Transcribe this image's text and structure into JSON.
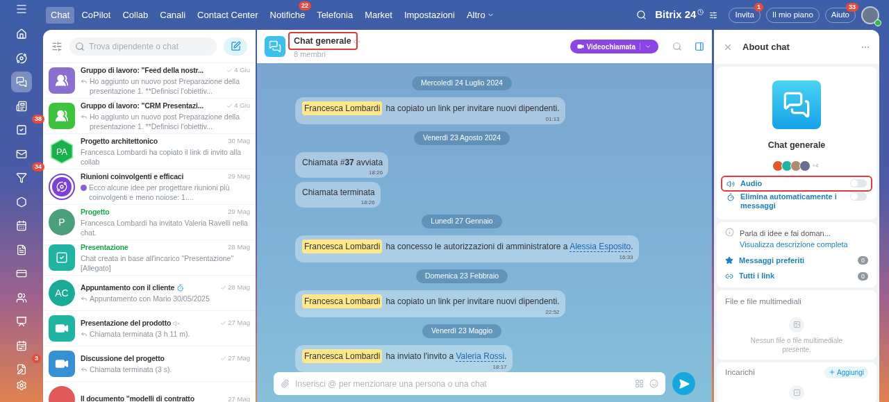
{
  "rail": {
    "items": [
      {
        "selected": false
      },
      {
        "selected": false
      },
      {
        "selected": true
      },
      {
        "selected": false
      },
      {
        "selected": false,
        "badge": "38"
      },
      {
        "selected": false
      },
      {
        "selected": false,
        "badge": "34"
      },
      {
        "selected": false
      },
      {
        "selected": false
      },
      {
        "selected": false
      },
      {
        "selected": false
      },
      {
        "selected": false
      },
      {
        "selected": false
      },
      {
        "selected": false
      },
      {
        "selected": false,
        "badge": "3"
      }
    ]
  },
  "nav": {
    "items": [
      {
        "label": "Chat",
        "selected": true,
        "dropdown": false
      },
      {
        "label": "CoPilot",
        "selected": false,
        "dropdown": false
      },
      {
        "label": "Collab",
        "selected": false,
        "dropdown": false
      },
      {
        "label": "Canali",
        "selected": false,
        "dropdown": false
      },
      {
        "label": "Contact Center",
        "selected": false,
        "dropdown": false
      },
      {
        "label": "Notifiche",
        "selected": false,
        "dropdown": false,
        "badge": "22"
      },
      {
        "label": "Telefonia",
        "selected": false,
        "dropdown": false
      },
      {
        "label": "Market",
        "selected": false,
        "dropdown": false
      },
      {
        "label": "Impostazioni",
        "selected": false,
        "dropdown": false
      },
      {
        "label": "Altro",
        "selected": false,
        "dropdown": true
      }
    ]
  },
  "header_right": {
    "logo": "Bitrix",
    "logo_num": "24",
    "buttons": [
      {
        "label": "Invita",
        "badge": "1"
      },
      {
        "label": "Il mio piano"
      },
      {
        "label": "Aiuto",
        "badge": "33"
      }
    ]
  },
  "chat_list": {
    "search_placeholder": "Trova dipendente o chat",
    "items": [
      {
        "title": "Gruppo di lavoro: \"Feed della nostr...",
        "date": "4 Giu",
        "preview": "Ho aggiunto un nuovo post Preparazione della presentazione 1. **Definisci l'obiettiv...",
        "read": true,
        "reply": true,
        "bot": false,
        "timer": false,
        "muted": false,
        "highlighted": false,
        "avatar": {
          "kind": "group",
          "color": "#8a6fd0"
        }
      },
      {
        "title": "Gruppo di lavoro: \"CRM Presentazi...",
        "date": "4 Giu",
        "preview": "Ho aggiunto un nuovo post Preparazione della presentazione 1. **Definisci l'obiettiv...",
        "read": true,
        "reply": true,
        "bot": false,
        "timer": false,
        "muted": false,
        "highlighted": false,
        "avatar": {
          "kind": "group",
          "color": "#3ec33e"
        }
      },
      {
        "title": "Progetto architettonico",
        "date": "30 Mag",
        "preview": "Francesca Lombardi ha copiato il link di invito alla collab",
        "read": false,
        "reply": false,
        "bot": false,
        "timer": false,
        "muted": false,
        "highlighted": false,
        "avatar": {
          "kind": "hexagon",
          "color": "#19b24a",
          "initials": "PA"
        }
      },
      {
        "title": "Riunioni coinvolgenti e efficaci",
        "date": "29 Mag",
        "preview": "Ecco alcune idee per progettare riunioni più coinvolgenti e meno noiose: 1....",
        "read": false,
        "reply": false,
        "bot": true,
        "timer": false,
        "muted": false,
        "highlighted": false,
        "avatar": {
          "kind": "copilot",
          "color": "#7b3fe0"
        }
      },
      {
        "title": "Progetto",
        "date": "29 Mag",
        "preview": "Francesca Lombardi ha invitato Valeria Ravelli nella chat.",
        "read": false,
        "reply": false,
        "bot": false,
        "timer": false,
        "muted": false,
        "highlighted": true,
        "avatar": {
          "kind": "initials",
          "color": "#4aa07a",
          "initials": "P"
        }
      },
      {
        "title": "Presentazione",
        "date": "28 Mag",
        "preview": "Chat creata in base all'incarico \"Presentazione\" [Allegato]",
        "read": false,
        "reply": false,
        "bot": false,
        "timer": false,
        "muted": false,
        "highlighted": true,
        "avatar": {
          "kind": "task",
          "color": "#1fb5a2"
        }
      },
      {
        "title": "Appuntamento con il cliente",
        "date": "28 Mag",
        "preview": "Appuntamento con Mario 30/05/2025",
        "read": true,
        "reply": true,
        "bot": false,
        "timer": true,
        "muted": false,
        "highlighted": false,
        "avatar": {
          "kind": "initials",
          "color": "#1aab98",
          "initials": "AC"
        }
      },
      {
        "title": "Presentazione del prodotto",
        "date": "27 Mag",
        "preview": "Chiamata terminata (3 h 11 m).",
        "read": true,
        "reply": true,
        "bot": false,
        "timer": false,
        "muted": true,
        "highlighted": false,
        "avatar": {
          "kind": "video",
          "color": "#1fb5a2"
        }
      },
      {
        "title": "Discussione del progetto",
        "date": "27 Mag",
        "preview": "Chiamata terminata (3 s).",
        "read": true,
        "reply": true,
        "bot": false,
        "timer": false,
        "muted": false,
        "highlighted": false,
        "avatar": {
          "kind": "video",
          "color": "#3591d4"
        }
      },
      {
        "title": "Il documento \"modelli di contratto",
        "date": "27 Mag",
        "read": false,
        "reply": false,
        "bot": false,
        "timer": false,
        "muted": false,
        "highlighted": false,
        "avatar": {
          "kind": "plain",
          "color": "#e05a5a"
        }
      }
    ]
  },
  "chat": {
    "title": "Chat generale",
    "subtitle": "8 membri",
    "muted": true,
    "highlighted": true,
    "call_button": "Videochiamata",
    "timeline": [
      {
        "kind": "date",
        "text": "Mercoledì 24 Luglio 2024"
      },
      {
        "kind": "message",
        "author": "Francesca Lombardi",
        "text": "ha copiato un link per invitare nuovi dipendenti.",
        "time": "01:13"
      },
      {
        "kind": "date",
        "text": "Venerdì 23 Agosto 2024"
      },
      {
        "kind": "message",
        "text": "Chiamata #**37** avviata",
        "time": "18:26"
      },
      {
        "kind": "message",
        "text": "Chiamata terminata",
        "time": "18:26"
      },
      {
        "kind": "date",
        "text": "Lunedì 27 Gennaio"
      },
      {
        "kind": "message",
        "author": "Francesca Lombardi",
        "text": "ha concesso le autorizzazioni di amministratore a",
        "link": "Alessia Esposito",
        "after": ".",
        "time": "16:33"
      },
      {
        "kind": "date",
        "text": "Domenica 23 Febbraio"
      },
      {
        "kind": "message",
        "author": "Francesca Lombardi",
        "text": "ha copiato un link per invitare nuovi dipendenti.",
        "time": "22:52"
      },
      {
        "kind": "date",
        "text": "Venerdì 23 Maggio"
      },
      {
        "kind": "message",
        "author": "Francesca Lombardi",
        "text": "ha inviato l'invito a",
        "link": "Valeria Rossi",
        "after": ".",
        "time": "18:17"
      }
    ],
    "composer_placeholder": "Inserisci @ per menzionare una persona o una chat"
  },
  "about": {
    "title": "About chat",
    "name": "Chat generale",
    "members_more": "+4",
    "settings": [
      {
        "label": "Audio",
        "on": false,
        "highlighted": true
      },
      {
        "label": "Elimina automaticamente i messaggi",
        "on": false,
        "highlighted": false
      }
    ],
    "description": "Parla di idee e fai doman...",
    "description_link": "Visualizza descrizione completa",
    "links": [
      {
        "label": "Messaggi preferiti",
        "count": "0"
      },
      {
        "label": "Tutti i link",
        "count": "0"
      }
    ],
    "files": {
      "title": "File e file multimediali",
      "empty": "Nessun file o file multimediale presente."
    },
    "tasks": {
      "title": "Incarichi",
      "add": "Aggiungi"
    }
  }
}
